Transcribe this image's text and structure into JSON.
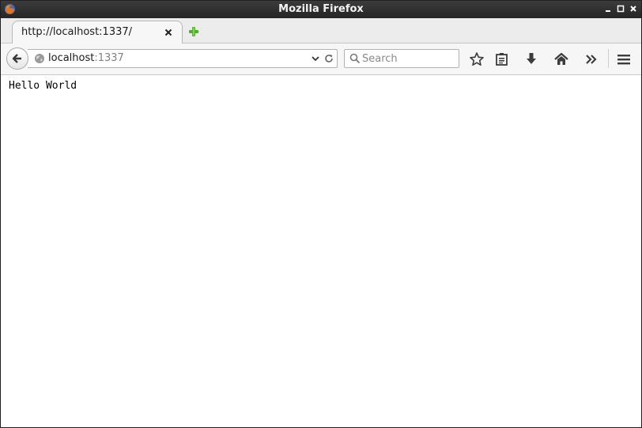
{
  "window": {
    "title": "Mozilla Firefox",
    "app_icon": "firefox-icon",
    "controls": [
      "minimize-icon",
      "maximize-icon",
      "close-icon"
    ]
  },
  "tabs": [
    {
      "label": "http://localhost:1337/",
      "active": true,
      "close_icon": "close-icon"
    }
  ],
  "new_tab_icon": "plus-icon",
  "navbar": {
    "back_icon": "back-arrow-icon",
    "url": {
      "host": "localhost",
      "port": ":1337",
      "site_icon": "globe-icon",
      "dropdown_icon": "chevron-down-icon",
      "reload_icon": "reload-icon"
    },
    "search": {
      "placeholder": "Search",
      "icon": "search-icon"
    },
    "toolbar_icons": [
      "star-icon",
      "reading-list-icon",
      "download-icon",
      "home-icon",
      "overflow-chevron-icon",
      "menu-icon"
    ]
  },
  "page": {
    "body_text": "Hello World"
  },
  "colors": {
    "titlebar": "#2e2e2e",
    "tab_active": "#f7f7f7",
    "toolbar": "#f6f6f6",
    "new_tab_plus": "#4caf2a"
  }
}
